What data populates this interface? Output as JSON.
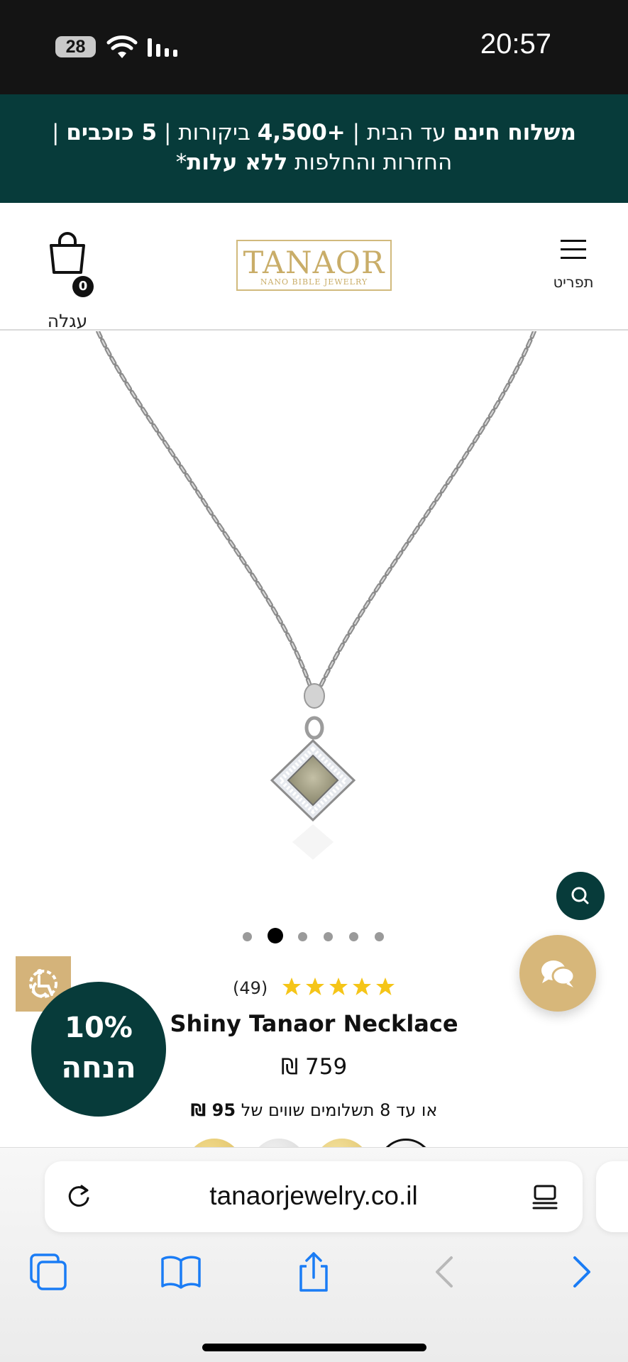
{
  "status_bar": {
    "battery": "28",
    "time": "20:57"
  },
  "promo": {
    "line1_bold_shipping": "משלוח חינם",
    "line1_to_home": "עד הבית |",
    "line1_bold_count": "+4,500",
    "line1_reviews": "ביקורות |",
    "line1_bold_stars": "5 כוכבים",
    "line1_end": "|",
    "line2_text": "החזרות והחלפות",
    "line2_bold": "ללא עלות",
    "line2_star": "*"
  },
  "header": {
    "menu_label": "תפריט",
    "logo_main": "TANAOR",
    "logo_sub": "NANO BIBLE JEWELRY",
    "cart_count": "0",
    "cart_label": "עגלה"
  },
  "gallery": {
    "total_slides": 6,
    "active_slide": 2
  },
  "product": {
    "rating_count": "(49)",
    "rating": 5,
    "title": "Shiny Tanaor Necklace",
    "price": "759 ₪",
    "installments_prefix": "או עד 8 תשלומים שווים של",
    "installments_amount": "95 ₪"
  },
  "discount": {
    "percent": "10%",
    "word": "הנחה"
  },
  "swatches": [
    "#d8b75a",
    "#d9d9d9",
    "#e2c76e",
    "#ffffff"
  ],
  "browser": {
    "url": "tanaorjewelry.co.il"
  },
  "colors": {
    "brand_dark": "#073b3a",
    "brand_gold": "#d7b77a",
    "ios_blue": "#1a7cf5"
  }
}
